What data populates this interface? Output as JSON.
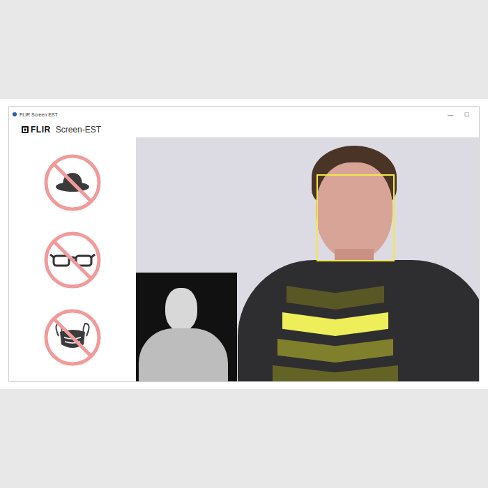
{
  "window": {
    "title": "FLIR Screen EST",
    "controls": [
      "—",
      "☐"
    ]
  },
  "logo": {
    "brand": "FLIR",
    "product": "Screen-EST"
  },
  "prohibited": [
    {
      "kind": "hat"
    },
    {
      "kind": "glasses"
    },
    {
      "kind": "mask"
    }
  ],
  "camera": {
    "face_box": {
      "detected": true
    }
  },
  "chevrons": [
    {
      "selected": false,
      "color": "#5e5c26"
    },
    {
      "selected": true,
      "color": "#eeee5a"
    },
    {
      "selected": false,
      "color": "#8a8a2c"
    },
    {
      "selected": false,
      "color": "#6a6926"
    }
  ]
}
